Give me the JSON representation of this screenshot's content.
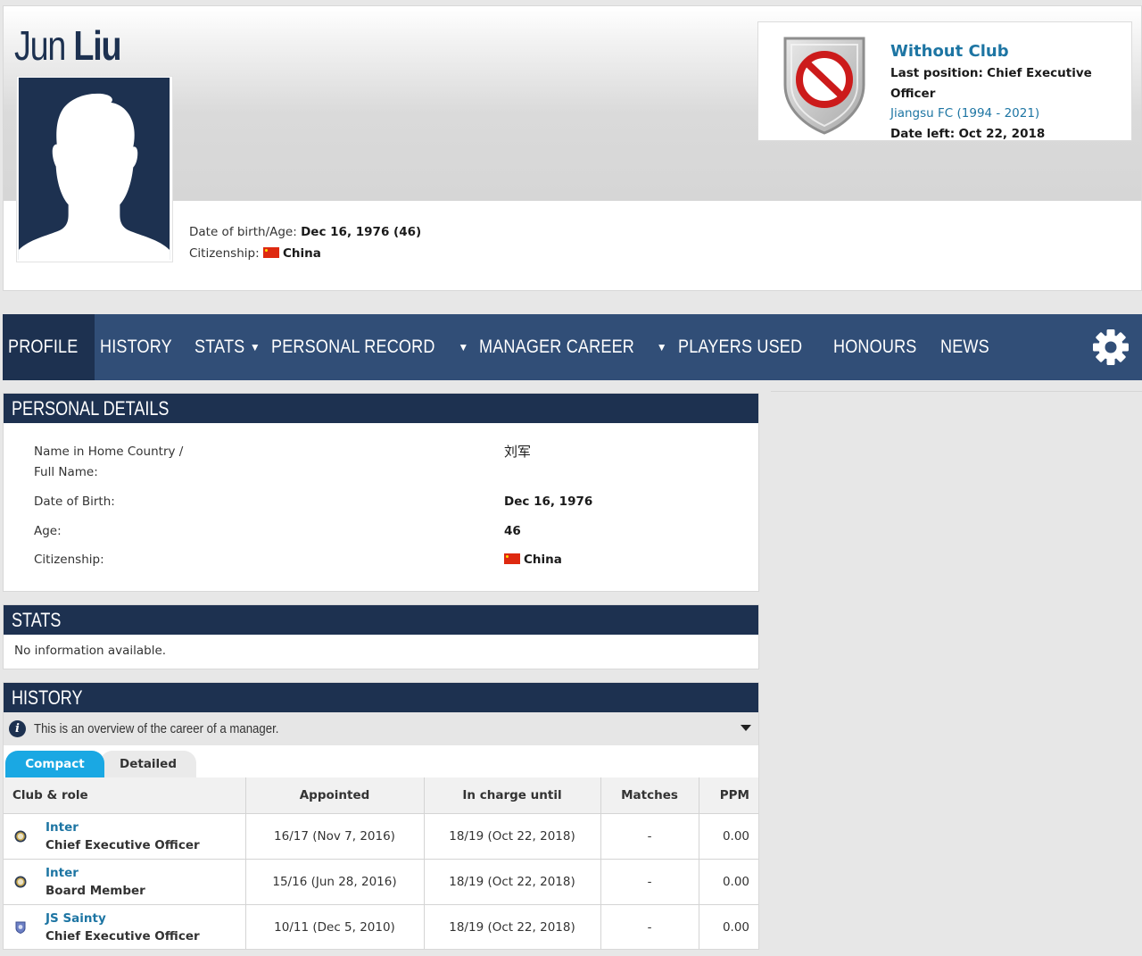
{
  "profile": {
    "first_name": "Jun",
    "last_name": "Liu",
    "dob_label": "Date of birth/Age:",
    "dob_value": "Dec 16, 1976 (46)",
    "citizenship_label": "Citizenship:",
    "citizenship_value": "China"
  },
  "club_box": {
    "status": "Without Club",
    "last_position_label": "Last position:",
    "last_position_value": "Chief Executive Officer",
    "club_link": "Jiangsu FC (1994 - 2021)",
    "date_left_label": "Date left:",
    "date_left_value": "Oct 22, 2018"
  },
  "nav": {
    "items": [
      {
        "label": "PROFILE"
      },
      {
        "label": "HISTORY"
      },
      {
        "label": "STATS"
      },
      {
        "label": "PERSONAL RECORD"
      },
      {
        "label": "MANAGER CAREER"
      },
      {
        "label": "PLAYERS USED"
      },
      {
        "label": "HONOURS"
      },
      {
        "label": "NEWS"
      }
    ]
  },
  "personal_details": {
    "title": "PERSONAL DETAILS",
    "rows": [
      {
        "label_line1": "Name in Home Country /",
        "label_line2": "Full Name:",
        "value": "刘军"
      },
      {
        "label": "Date of Birth:",
        "value": "Dec 16, 1976"
      },
      {
        "label": "Age:",
        "value": "46"
      },
      {
        "label": "Citizenship:",
        "value": "China"
      }
    ]
  },
  "stats": {
    "title": "STATS",
    "message": "No information available."
  },
  "history": {
    "title": "HISTORY",
    "info": "This is an overview of the career of a manager.",
    "tabs": {
      "compact": "Compact",
      "detailed": "Detailed"
    },
    "columns": [
      "Club & role",
      "Appointed",
      "In charge until",
      "Matches",
      "PPM"
    ],
    "rows": [
      {
        "club": "Inter",
        "role": "Chief Executive Officer",
        "appointed": "16/17 (Nov 7, 2016)",
        "until": "18/19 (Oct 22, 2018)",
        "matches": "-",
        "ppm": "0.00"
      },
      {
        "club": "Inter",
        "role": "Board Member",
        "appointed": "15/16 (Jun 28, 2016)",
        "until": "18/19 (Oct 22, 2018)",
        "matches": "-",
        "ppm": "0.00"
      },
      {
        "club": "JS Sainty",
        "role": "Chief Executive Officer",
        "appointed": "10/11 (Dec 5, 2010)",
        "until": "18/19 (Oct 22, 2018)",
        "matches": "-",
        "ppm": "0.00"
      }
    ]
  },
  "colors": {
    "navy": "#1d3150",
    "nav_bg": "#314e77",
    "link": "#1d75a3",
    "tab_active": "#1aa8e3",
    "flag_red": "#de2910"
  },
  "icons": {
    "photo": "silhouette-placeholder",
    "club_badge": "no-club-shield-icon",
    "settings": "gear-icon",
    "info": "info-icon",
    "expand": "chevron-down-icon"
  }
}
